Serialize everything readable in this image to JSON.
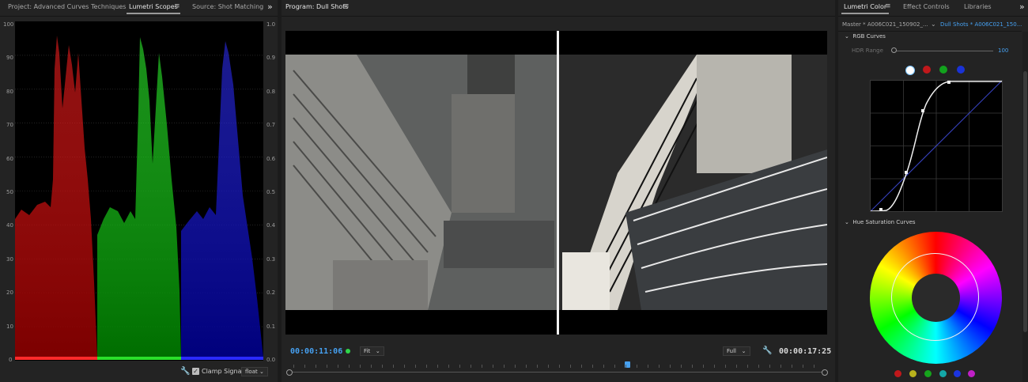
{
  "scopes_panel": {
    "tabs": [
      "Project: Advanced Curves Techniques",
      "Lumetri Scopes",
      "Source: Shot Matching"
    ],
    "active_tab": "Lumetri Scopes",
    "left_axis": [
      "100",
      "90",
      "80",
      "70",
      "60",
      "50",
      "40",
      "30",
      "20",
      "10",
      "0"
    ],
    "right_axis": [
      "1.0",
      "0.9",
      "0.8",
      "0.7",
      "0.6",
      "0.5",
      "0.4",
      "0.3",
      "0.2",
      "0.1",
      "0.0"
    ],
    "clamp_label": "Clamp Signal",
    "clamp_checked": true,
    "precision": "float"
  },
  "program_panel": {
    "title": "Program: Dull Shots",
    "timecode_current": "00:00:11:06",
    "timecode_total": "00:00:17:25",
    "fit_label": "Fit",
    "resolution": "Full",
    "accent": "#46a0f0"
  },
  "lumetri_panel": {
    "tabs": [
      "Lumetri Color",
      "Effect Controls",
      "Libraries"
    ],
    "master_clip": "Master * A006C021_150902_...",
    "sequence_clip": "Dull Shots * A006C021_150...",
    "rgb_curves_label": "RGB Curves",
    "hdr_label": "HDR Range",
    "hdr_value": "100",
    "hue_sat_label": "Hue Saturation Curves",
    "channel_colors": [
      "#ffffff",
      "#c0181b",
      "#12a21d",
      "#1a33d6"
    ],
    "swatch_colors": [
      "#c0181b",
      "#b8b11c",
      "#16a41c",
      "#14a7a8",
      "#1b34e0",
      "#c020c6"
    ]
  }
}
